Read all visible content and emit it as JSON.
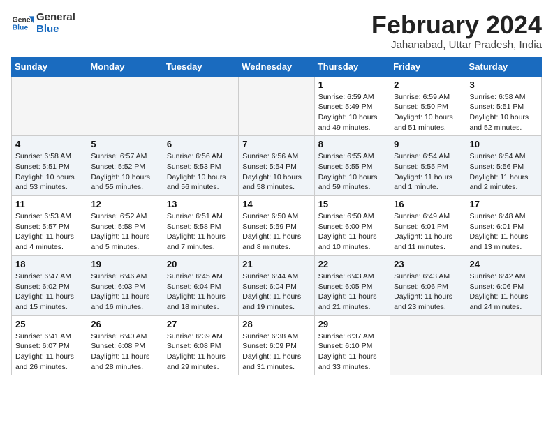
{
  "header": {
    "logo_general": "General",
    "logo_blue": "Blue",
    "month_title": "February 2024",
    "subtitle": "Jahanabad, Uttar Pradesh, India"
  },
  "weekdays": [
    "Sunday",
    "Monday",
    "Tuesday",
    "Wednesday",
    "Thursday",
    "Friday",
    "Saturday"
  ],
  "weeks": [
    [
      {
        "num": "",
        "info": ""
      },
      {
        "num": "",
        "info": ""
      },
      {
        "num": "",
        "info": ""
      },
      {
        "num": "",
        "info": ""
      },
      {
        "num": "1",
        "info": "Sunrise: 6:59 AM\nSunset: 5:49 PM\nDaylight: 10 hours\nand 49 minutes."
      },
      {
        "num": "2",
        "info": "Sunrise: 6:59 AM\nSunset: 5:50 PM\nDaylight: 10 hours\nand 51 minutes."
      },
      {
        "num": "3",
        "info": "Sunrise: 6:58 AM\nSunset: 5:51 PM\nDaylight: 10 hours\nand 52 minutes."
      }
    ],
    [
      {
        "num": "4",
        "info": "Sunrise: 6:58 AM\nSunset: 5:51 PM\nDaylight: 10 hours\nand 53 minutes."
      },
      {
        "num": "5",
        "info": "Sunrise: 6:57 AM\nSunset: 5:52 PM\nDaylight: 10 hours\nand 55 minutes."
      },
      {
        "num": "6",
        "info": "Sunrise: 6:56 AM\nSunset: 5:53 PM\nDaylight: 10 hours\nand 56 minutes."
      },
      {
        "num": "7",
        "info": "Sunrise: 6:56 AM\nSunset: 5:54 PM\nDaylight: 10 hours\nand 58 minutes."
      },
      {
        "num": "8",
        "info": "Sunrise: 6:55 AM\nSunset: 5:55 PM\nDaylight: 10 hours\nand 59 minutes."
      },
      {
        "num": "9",
        "info": "Sunrise: 6:54 AM\nSunset: 5:55 PM\nDaylight: 11 hours\nand 1 minute."
      },
      {
        "num": "10",
        "info": "Sunrise: 6:54 AM\nSunset: 5:56 PM\nDaylight: 11 hours\nand 2 minutes."
      }
    ],
    [
      {
        "num": "11",
        "info": "Sunrise: 6:53 AM\nSunset: 5:57 PM\nDaylight: 11 hours\nand 4 minutes."
      },
      {
        "num": "12",
        "info": "Sunrise: 6:52 AM\nSunset: 5:58 PM\nDaylight: 11 hours\nand 5 minutes."
      },
      {
        "num": "13",
        "info": "Sunrise: 6:51 AM\nSunset: 5:58 PM\nDaylight: 11 hours\nand 7 minutes."
      },
      {
        "num": "14",
        "info": "Sunrise: 6:50 AM\nSunset: 5:59 PM\nDaylight: 11 hours\nand 8 minutes."
      },
      {
        "num": "15",
        "info": "Sunrise: 6:50 AM\nSunset: 6:00 PM\nDaylight: 11 hours\nand 10 minutes."
      },
      {
        "num": "16",
        "info": "Sunrise: 6:49 AM\nSunset: 6:01 PM\nDaylight: 11 hours\nand 11 minutes."
      },
      {
        "num": "17",
        "info": "Sunrise: 6:48 AM\nSunset: 6:01 PM\nDaylight: 11 hours\nand 13 minutes."
      }
    ],
    [
      {
        "num": "18",
        "info": "Sunrise: 6:47 AM\nSunset: 6:02 PM\nDaylight: 11 hours\nand 15 minutes."
      },
      {
        "num": "19",
        "info": "Sunrise: 6:46 AM\nSunset: 6:03 PM\nDaylight: 11 hours\nand 16 minutes."
      },
      {
        "num": "20",
        "info": "Sunrise: 6:45 AM\nSunset: 6:04 PM\nDaylight: 11 hours\nand 18 minutes."
      },
      {
        "num": "21",
        "info": "Sunrise: 6:44 AM\nSunset: 6:04 PM\nDaylight: 11 hours\nand 19 minutes."
      },
      {
        "num": "22",
        "info": "Sunrise: 6:43 AM\nSunset: 6:05 PM\nDaylight: 11 hours\nand 21 minutes."
      },
      {
        "num": "23",
        "info": "Sunrise: 6:43 AM\nSunset: 6:06 PM\nDaylight: 11 hours\nand 23 minutes."
      },
      {
        "num": "24",
        "info": "Sunrise: 6:42 AM\nSunset: 6:06 PM\nDaylight: 11 hours\nand 24 minutes."
      }
    ],
    [
      {
        "num": "25",
        "info": "Sunrise: 6:41 AM\nSunset: 6:07 PM\nDaylight: 11 hours\nand 26 minutes."
      },
      {
        "num": "26",
        "info": "Sunrise: 6:40 AM\nSunset: 6:08 PM\nDaylight: 11 hours\nand 28 minutes."
      },
      {
        "num": "27",
        "info": "Sunrise: 6:39 AM\nSunset: 6:08 PM\nDaylight: 11 hours\nand 29 minutes."
      },
      {
        "num": "28",
        "info": "Sunrise: 6:38 AM\nSunset: 6:09 PM\nDaylight: 11 hours\nand 31 minutes."
      },
      {
        "num": "29",
        "info": "Sunrise: 6:37 AM\nSunset: 6:10 PM\nDaylight: 11 hours\nand 33 minutes."
      },
      {
        "num": "",
        "info": ""
      },
      {
        "num": "",
        "info": ""
      }
    ]
  ]
}
